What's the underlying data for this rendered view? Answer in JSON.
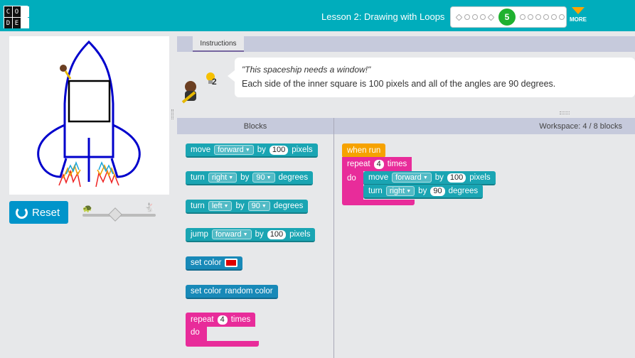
{
  "header": {
    "logo_letters": [
      "C",
      "O",
      "D",
      "E"
    ],
    "lesson_title": "Lesson 2: Drawing with Loops",
    "current_level": "5",
    "more_label": "MORE",
    "brand_color": "#00adbc"
  },
  "left": {
    "reset_label": "Reset",
    "speed_slider": {
      "level": 0.42
    }
  },
  "instructions": {
    "tab_label": "Instructions",
    "hint_count": "2",
    "quote": "\"This spaceship needs a window!\"",
    "text": "Each side of the inner square is 100 pixels and all of the angles are 90 degrees."
  },
  "toolbox": {
    "header": "Blocks",
    "move": {
      "label": "move",
      "direction": "forward",
      "by": "by",
      "value": "100",
      "unit": "pixels"
    },
    "turn_right": {
      "label": "turn",
      "direction": "right",
      "by": "by",
      "value": "90",
      "unit": "degrees"
    },
    "turn_left": {
      "label": "turn",
      "direction": "left",
      "by": "by",
      "value": "90",
      "unit": "degrees"
    },
    "jump": {
      "label": "jump",
      "direction": "forward",
      "by": "by",
      "value": "100",
      "unit": "pixels"
    },
    "set_color": {
      "label": "set color",
      "color": "#e00000"
    },
    "set_random": {
      "label": "set color",
      "value": "random color"
    },
    "repeat": {
      "label": "repeat",
      "count": "4",
      "times": "times",
      "do": "do"
    }
  },
  "workspace": {
    "header": "Workspace: 4 / 8 blocks",
    "when_run": "when run",
    "repeat": {
      "label": "repeat",
      "count": "4",
      "times": "times",
      "do": "do"
    },
    "move": {
      "label": "move",
      "direction": "forward",
      "by": "by",
      "value": "100",
      "unit": "pixels"
    },
    "turn": {
      "label": "turn",
      "direction": "right",
      "by": "by",
      "value": "90",
      "unit": "degrees"
    }
  }
}
